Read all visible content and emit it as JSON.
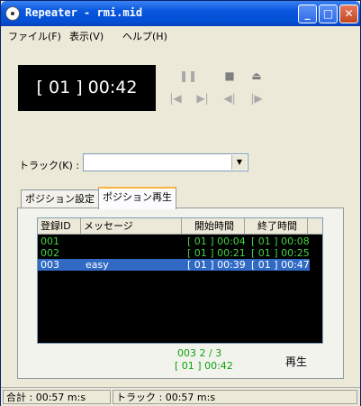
{
  "window": {
    "title": "Repeater - rmi.mid"
  },
  "title_buttons": {
    "minimize": "_",
    "maximize": "□",
    "close": "✕"
  },
  "menu": [
    "ファイル(F)",
    "表示(V)",
    "ヘルプ(H)"
  ],
  "display": {
    "time": "[ 01 ] 00:42"
  },
  "controls": {
    "pause": "❚❚",
    "stop": "■",
    "eject": "⏏",
    "prev": "|◀",
    "next": "▶|",
    "rewind": "◀|",
    "forward": "|▶"
  },
  "track": {
    "label": "トラック(K) :",
    "value": ""
  },
  "tabs": [
    "ポジション設定",
    "ポジション再生"
  ],
  "list": {
    "columns": [
      "登録ID",
      "メッセージ",
      "開始時間",
      "終了時間"
    ],
    "rows": [
      {
        "id": "001",
        "message": "",
        "start": "[ 01 ] 00:04",
        "end": "[ 01 ] 00:08",
        "selected": false
      },
      {
        "id": "002",
        "message": "",
        "start": "[ 01 ] 00:21",
        "end": "[ 01 ] 00:25",
        "selected": false
      },
      {
        "id": "003",
        "message": "easy",
        "start": "[ 01 ] 00:39",
        "end": "[ 01 ] 00:47",
        "selected": true
      }
    ]
  },
  "position_info": {
    "line1": "003   2 / 3",
    "line2": "[ 01 ] 00:42"
  },
  "play_label": "再生",
  "status": {
    "total": "合計 : 00:57 m:s",
    "track": "トラック : 00:57 m:s"
  }
}
